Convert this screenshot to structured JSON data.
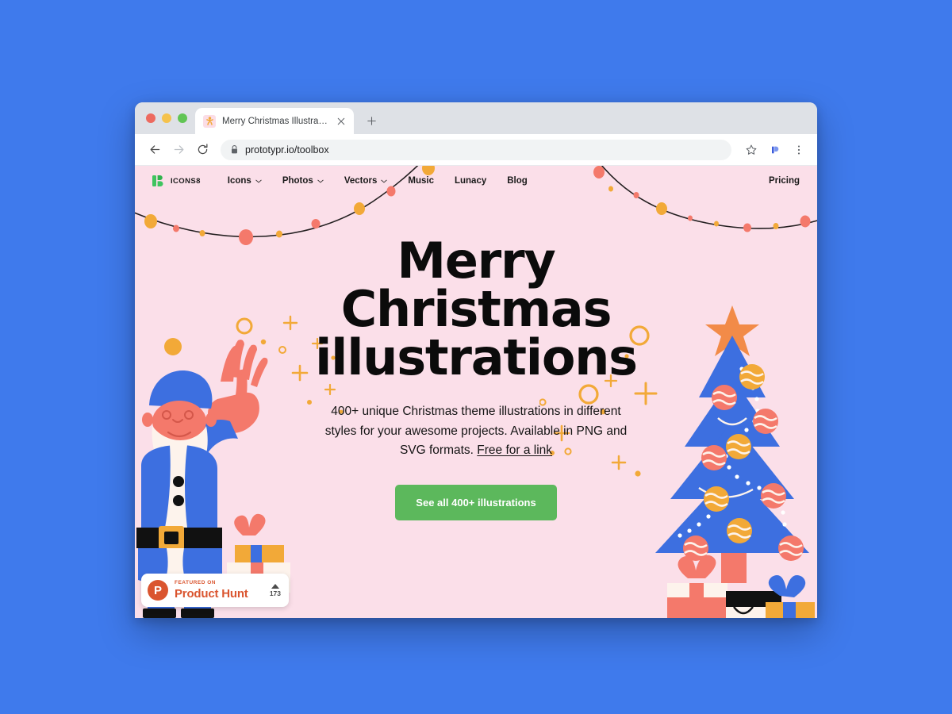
{
  "theme": {
    "desktop_bg": "#3f7aec",
    "page_bg": "#fbdfe9",
    "accent_blue": "#3d6fe0",
    "accent_coral": "#f4796b",
    "accent_gold": "#f2a938",
    "cta_green": "#5cb85c",
    "text_dark": "#0b0b0b",
    "ph_orange": "#da552f"
  },
  "browser": {
    "tab": {
      "title": "Merry Christmas Illustrations",
      "favicon_name": "gingerbread-man-favicon",
      "close_label": "×"
    },
    "new_tab_label": "+",
    "traffic_lights": [
      "close",
      "minimize",
      "zoom"
    ],
    "toolbar": {
      "back_label": "←",
      "forward_label": "→",
      "reload_label": "⟳",
      "url": "prototypr.io/toolbox",
      "lock_name": "lock-icon",
      "bookmark_name": "star-icon",
      "extension_name": "extension-icon",
      "menu_label": "⋮"
    }
  },
  "site": {
    "brand": {
      "name": "ICONS8",
      "mark_name": "icons8-logo-mark"
    },
    "nav": [
      {
        "label": "Icons",
        "has_dropdown": true
      },
      {
        "label": "Photos",
        "has_dropdown": true
      },
      {
        "label": "Vectors",
        "has_dropdown": true
      },
      {
        "label": "Music",
        "has_dropdown": false
      },
      {
        "label": "Lunacy",
        "has_dropdown": false
      },
      {
        "label": "Blog",
        "has_dropdown": false
      }
    ],
    "nav_right": {
      "label": "Pricing"
    }
  },
  "hero": {
    "title_line1": "Merry",
    "title_line2": "Christmas",
    "title_line3": "illustrations",
    "body_text": "400+ unique Christmas theme illustrations in different styles for your awesome projects. Available in PNG and SVG formats. ",
    "body_link": "Free for a link",
    "cta_label": "See all 400+ illustrations"
  },
  "illustrations": {
    "garland_name": "christmas-light-garland",
    "santa_name": "waving-santa-illustration",
    "tree_name": "christmas-tree-illustration",
    "sparkles_name": "sparkle-decorations"
  },
  "product_hunt": {
    "logo_letter": "P",
    "featured_text": "FEATURED ON",
    "product_name": "Product Hunt",
    "vote_count": "173"
  }
}
